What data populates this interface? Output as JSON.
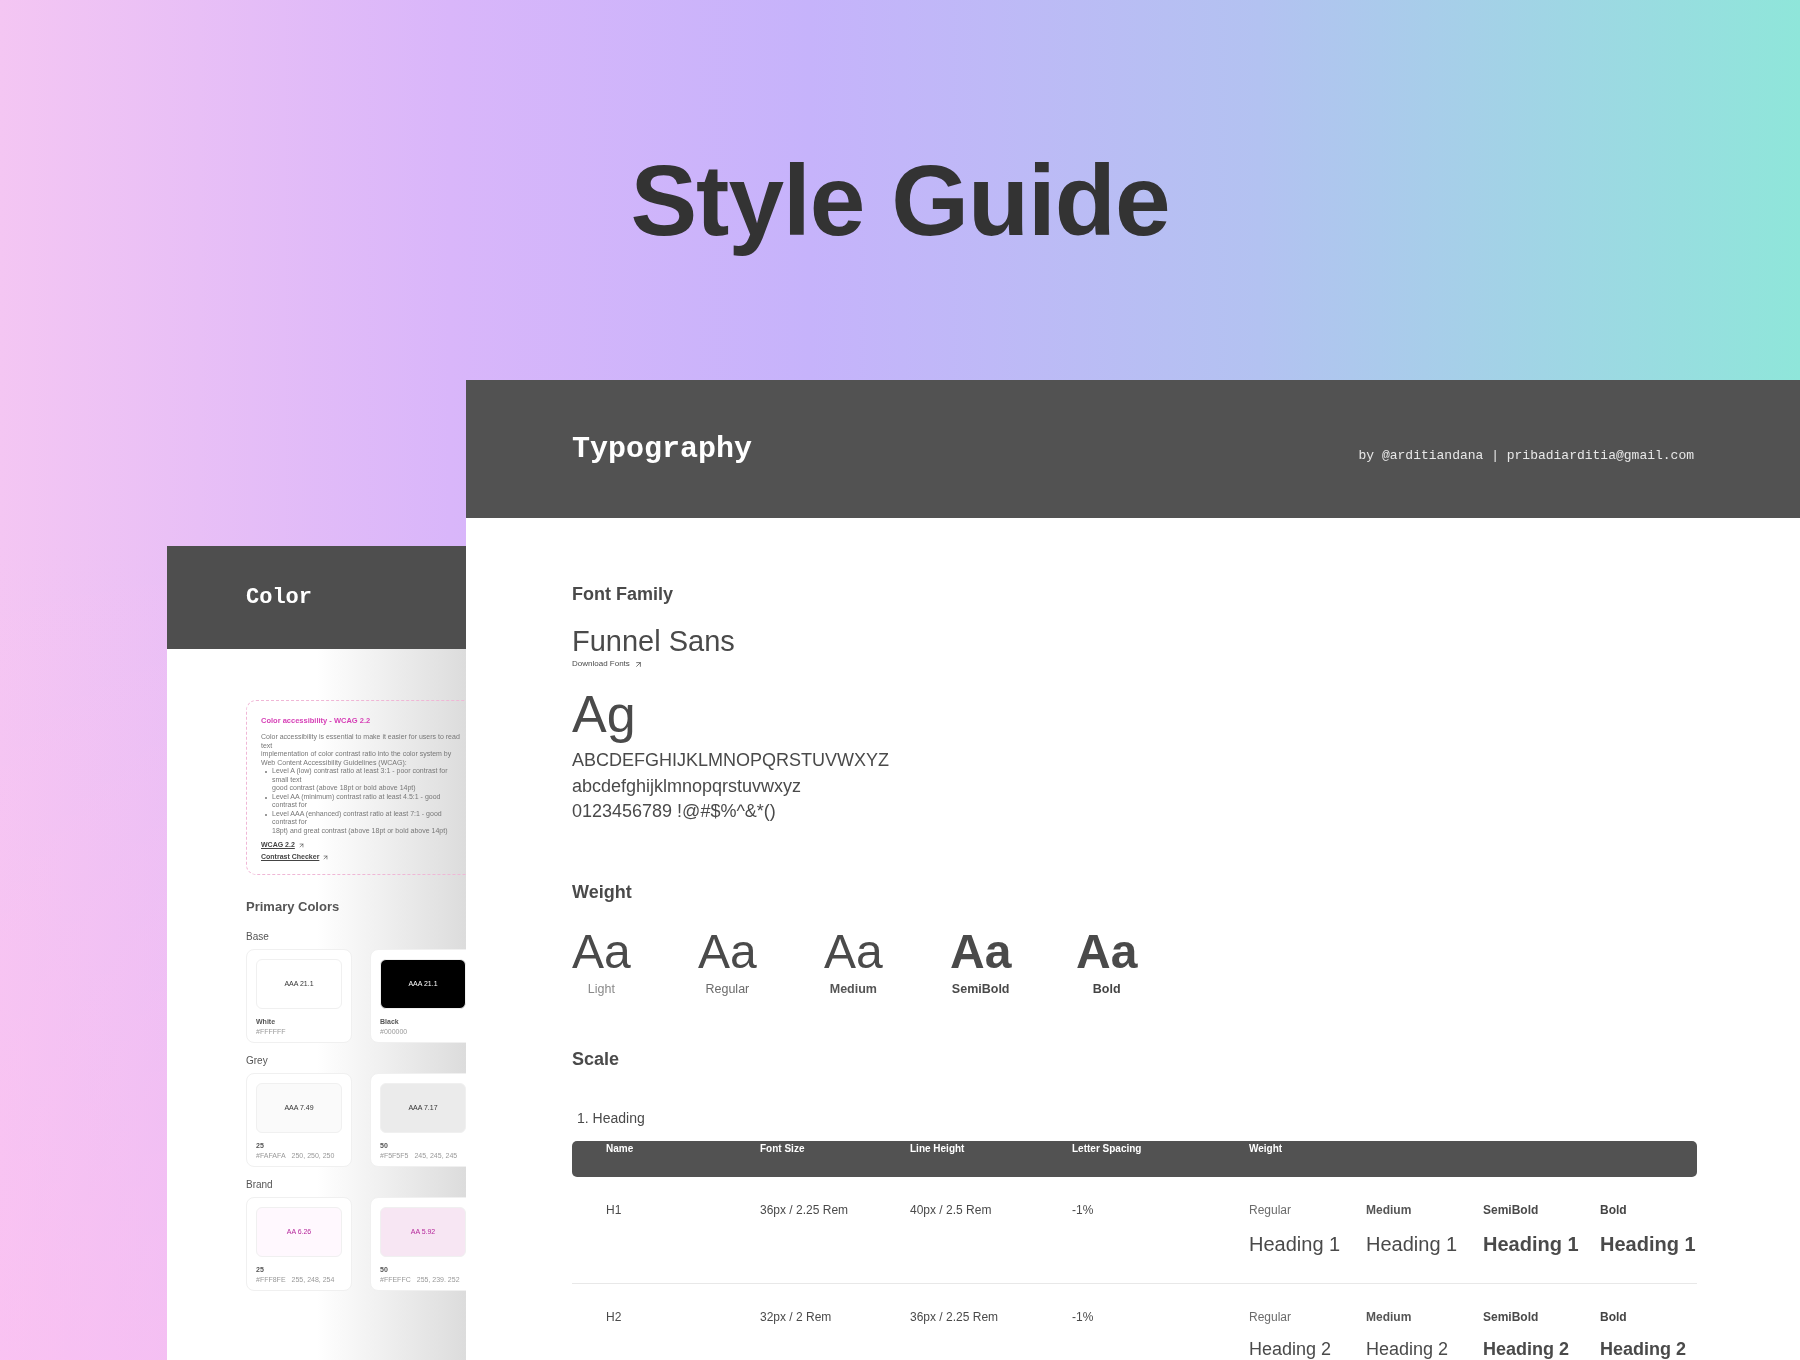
{
  "title": "Style Guide",
  "color_panel": {
    "title": "Color",
    "accessibility": {
      "heading": "Color accessibility - WCAG 2.2",
      "intro_lines": [
        "Color accessibility is essential to make it easier for users to read text",
        "implementation of color contrast ratio into the color system by",
        "Web Content Accessibility Guidelines (WCAG):"
      ],
      "bullets": [
        [
          "Level A (low) contrast ratio at least 3:1 - poor contrast for small text",
          "good contrast (above 18pt or bold above 14pt)"
        ],
        [
          "Level AA (minimum) contrast ratio at least 4.5:1 - good contrast for"
        ],
        [
          "Level AAA (enhanced) contrast ratio at least 7:1 - good contrast for",
          "18pt) and great contrast (above 18pt or bold above 14pt)"
        ]
      ],
      "links": [
        "WCAG 2.2",
        "Contrast Checker"
      ]
    },
    "section": "Primary Colors",
    "groups": [
      {
        "name": "Base",
        "kind": "base",
        "swatches": [
          {
            "badge": "AAA 21.1",
            "color": "#ffffff",
            "name": "White",
            "hex": "#FFFFFF"
          },
          {
            "badge": "AAA 21.1",
            "color": "#000000",
            "name": "Black",
            "hex": "#000000"
          }
        ]
      },
      {
        "name": "Grey",
        "kind": "grey",
        "swatches": [
          {
            "badge": "AAA 7.49",
            "color": "#fafafa",
            "name": "25",
            "hex": "#FAFAFA",
            "rgb": "250, 250, 250"
          },
          {
            "badge": "AAA 7.17",
            "color": "#ebebeb",
            "name": "50",
            "hex": "#F5F5F5",
            "rgb": "245, 245, 245"
          }
        ]
      },
      {
        "name": "Brand",
        "kind": "brand",
        "swatches": [
          {
            "badge": "AA 6.26",
            "color": "#fff8fe",
            "name": "25",
            "hex": "#FFF8FE",
            "rgb": "255, 248, 254"
          },
          {
            "badge": "AA 5.92",
            "color": "#f7e6f3",
            "name": "50",
            "hex": "#FFEFFC",
            "rgb": "255, 239. 252"
          }
        ]
      }
    ]
  },
  "typography_panel": {
    "title": "Typography",
    "byline": "by @arditiandana | pribadiarditia@gmail.com",
    "font_family": {
      "heading": "Font Family",
      "name": "Funnel Sans",
      "link": "Download Fonts",
      "specimen": "Ag",
      "lines": [
        "ABCDEFGHIJKLMNOPQRSTUVWXYZ",
        "abcdefghijklmnopqrstuvwxyz",
        "0123456789 !@#$%^&*()"
      ]
    },
    "weight": {
      "heading": "Weight",
      "items": [
        {
          "sample": "Aa",
          "label": "Light",
          "kind": "light"
        },
        {
          "sample": "Aa",
          "label": "Regular",
          "kind": "regular"
        },
        {
          "sample": "Aa",
          "label": "Medium",
          "kind": "medium"
        },
        {
          "sample": "Aa",
          "label": "SemiBold",
          "kind": "semibold"
        },
        {
          "sample": "Aa",
          "label": "Bold",
          "kind": "bold"
        }
      ]
    },
    "scale": {
      "heading": "Scale",
      "subheading": "1. Heading",
      "table": {
        "columns": [
          "Name",
          "Font Size",
          "Line Height",
          "Letter Spacing",
          "Weight"
        ],
        "rows": [
          {
            "kind": "h1",
            "name": "H1",
            "font_size": "36px / 2.25 Rem",
            "line_height": "40px / 2.5 Rem",
            "letter_spacing": "-1%",
            "samples": [
              {
                "weight": "Regular",
                "text": "Heading 1",
                "kind": "regular"
              },
              {
                "weight": "Medium",
                "text": "Heading 1",
                "kind": "medium"
              },
              {
                "weight": "SemiBold",
                "text": "Heading 1",
                "kind": "semibold"
              },
              {
                "weight": "Bold",
                "text": "Heading 1",
                "kind": "bold"
              }
            ]
          },
          {
            "kind": "h2",
            "name": "H2",
            "font_size": "32px / 2 Rem",
            "line_height": "36px / 2.25 Rem",
            "letter_spacing": "-1%",
            "samples": [
              {
                "weight": "Regular",
                "text": "Heading 2",
                "kind": "regular"
              },
              {
                "weight": "Medium",
                "text": "Heading 2",
                "kind": "medium"
              },
              {
                "weight": "SemiBold",
                "text": "Heading 2",
                "kind": "semibold"
              },
              {
                "weight": "Bold",
                "text": "Heading 2",
                "kind": "bold"
              }
            ]
          }
        ]
      }
    }
  }
}
